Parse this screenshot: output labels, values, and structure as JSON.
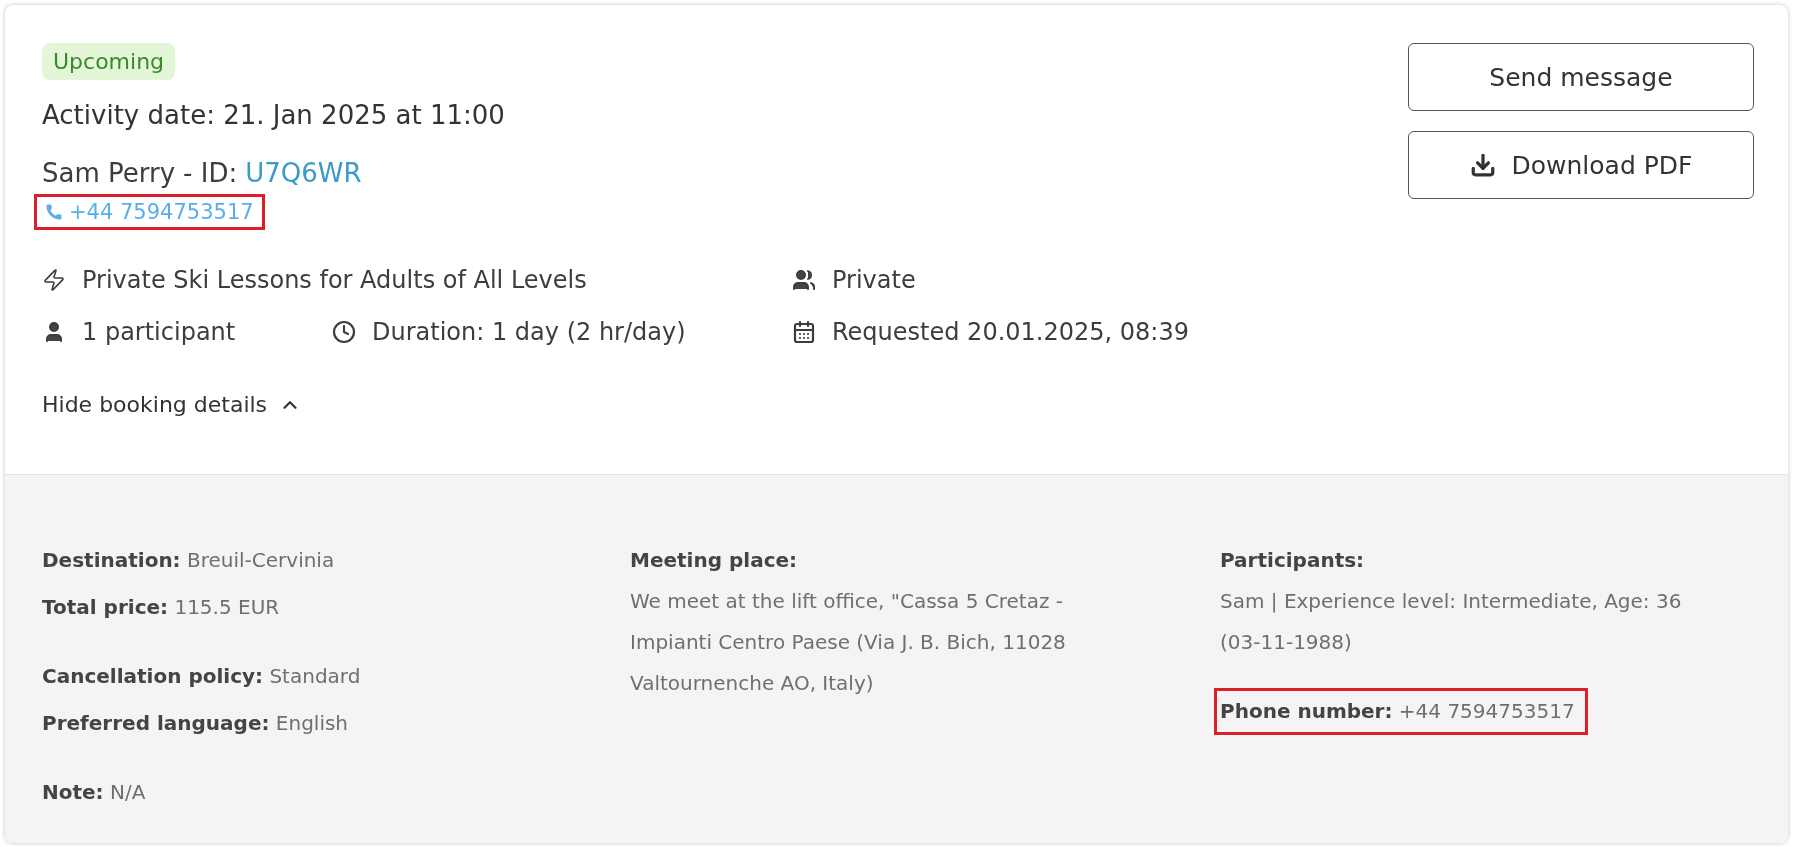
{
  "booking": {
    "status": "Upcoming",
    "activity_date": "Activity date: 21. Jan 2025 at 11:00",
    "customer_name": "Sam Perry",
    "id_label": "- ID:",
    "id": "U7Q6WR",
    "phone": {
      "text": "+44 7594753517",
      "highlighted": true
    },
    "info": [
      {
        "kind": "activity",
        "text": "Private Ski Lessons for Adults of All Levels"
      },
      {
        "kind": "group",
        "text": "Private"
      },
      {
        "kind": "person",
        "text": "1 participant"
      },
      {
        "kind": "clock",
        "text": "Duration: 1 day (2 hr/day)"
      },
      {
        "kind": "calendar",
        "text": "Requested 20.01.2025, 08:39"
      }
    ],
    "toggle": {
      "label": "Hide booking details",
      "expanded": true
    }
  },
  "actions": [
    {
      "kind": "message",
      "label": "Send message"
    },
    {
      "kind": "download",
      "label": "Download PDF"
    }
  ],
  "details": {
    "columns": [
      {
        "groups": [
          [
            {
              "label": "Destination:",
              "value": "Breuil-Cervinia",
              "highlighted": false
            },
            {
              "label": "Total price:",
              "value": "115.5 EUR",
              "highlighted": false
            }
          ],
          [
            {
              "label": "Cancellation policy:",
              "value": "Standard",
              "highlighted": false
            },
            {
              "label": "Preferred language:",
              "value": "English",
              "highlighted": false
            }
          ],
          [
            {
              "label": "Note:",
              "value": "N/A",
              "highlighted": false
            }
          ]
        ]
      },
      {
        "groups": [
          [
            {
              "label": "Meeting place:",
              "value": "We meet at the lift office, \"Cassa 5 Cretaz - Impianti Centro Paese (Via J. B. Bich, 11028 Valtournenche AO, Italy)",
              "highlighted": false,
              "block": true
            }
          ]
        ]
      },
      {
        "groups": [
          [
            {
              "label": "Participants:",
              "value": "Sam | Experience level: Intermediate, Age: 36 (03-11-1988)",
              "highlighted": false,
              "block": true
            }
          ],
          [
            {
              "label": "Phone number:",
              "value": "+44 7594753517",
              "highlighted": true
            }
          ]
        ]
      }
    ]
  }
}
